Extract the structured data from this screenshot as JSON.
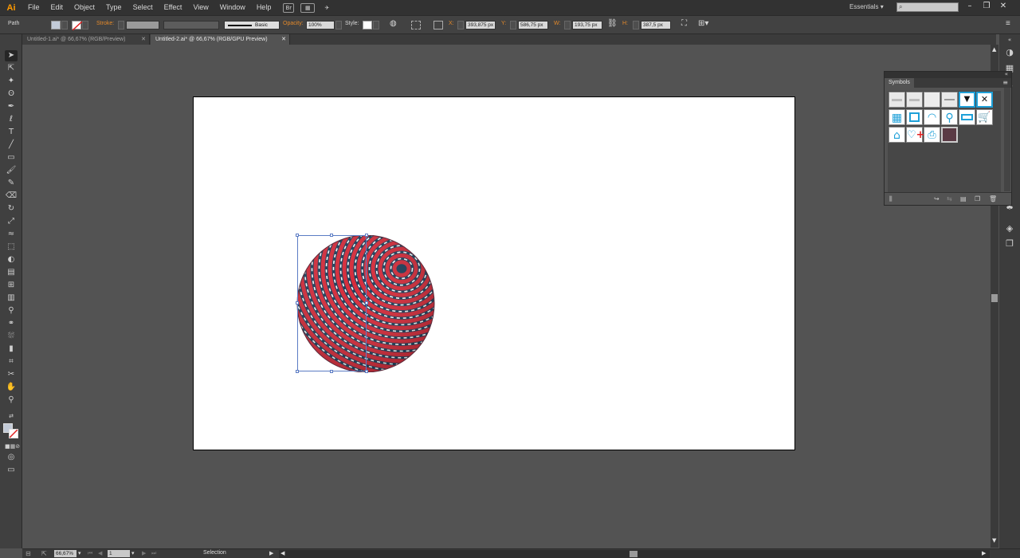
{
  "app": {
    "logo": "Ai"
  },
  "menu": [
    "File",
    "Edit",
    "Object",
    "Type",
    "Select",
    "Effect",
    "View",
    "Window",
    "Help"
  ],
  "bridge_label": "Br",
  "workspace": "Essentials",
  "control": {
    "selection_type": "Path",
    "stroke_label": "Stroke:",
    "brush_label": "Basic",
    "opacity_label": "Opacity:",
    "opacity_value": "100%",
    "style_label": "Style:",
    "x_label": "X:",
    "x_value": "393,875 px",
    "y_label": "Y:",
    "y_value": "586,75 px",
    "w_label": "W:",
    "w_value": "193,75 px",
    "h_label": "H:",
    "h_value": "387,5 px"
  },
  "tabs": [
    {
      "label": "Untitled-1.ai* @ 66,67% (RGB/Preview)",
      "active": false
    },
    {
      "label": "Untitled-2.ai* @ 66,67% (RGB/GPU Preview)",
      "active": true
    }
  ],
  "symbols_panel": {
    "title": "Symbols"
  },
  "status": {
    "zoom": "66,67%",
    "page": "1",
    "tool": "Selection"
  },
  "colors": {
    "accent": "#e3892a",
    "selection": "#5b7cc4",
    "sphere_red": "#d62b3a",
    "sphere_navy": "#1c3f5b",
    "symbol_blue": "#1ea0d8"
  }
}
